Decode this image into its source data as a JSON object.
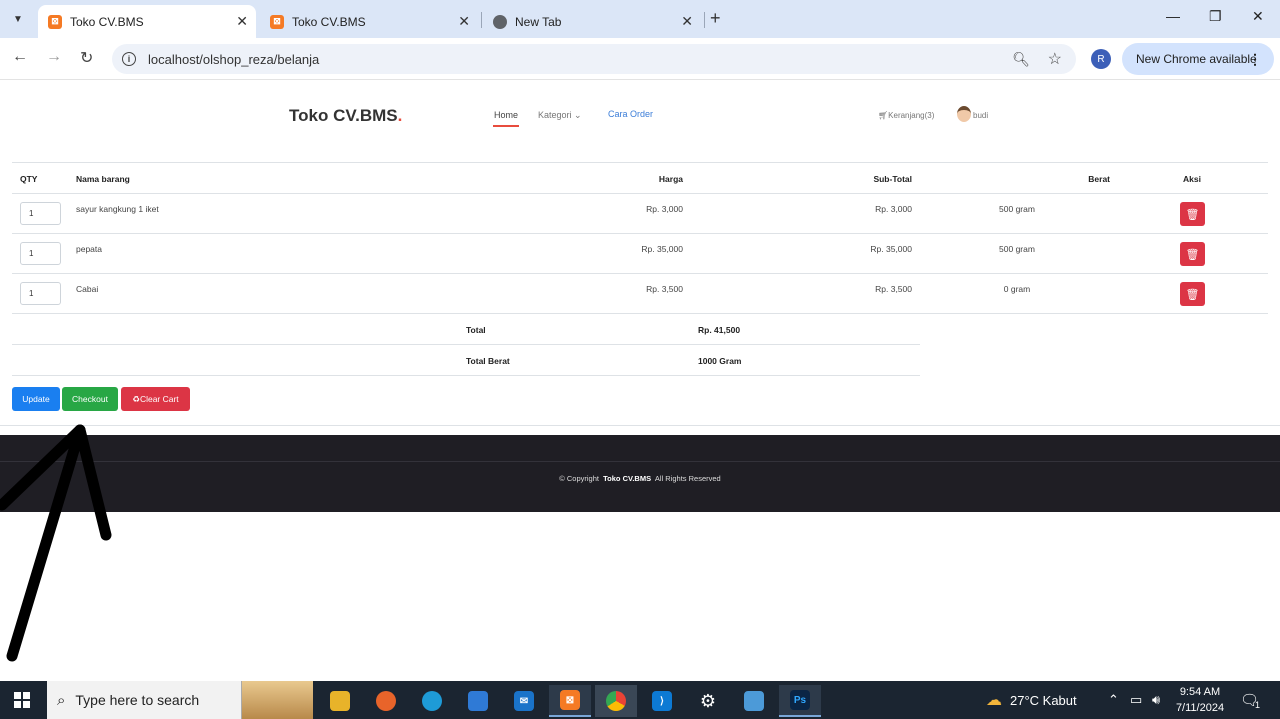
{
  "browser": {
    "tabs": [
      {
        "title": "Toko CV.BMS",
        "favicon": "xampp-icon",
        "active": true
      },
      {
        "title": "Toko CV.BMS",
        "favicon": "xampp-icon",
        "active": false
      },
      {
        "title": "New Tab",
        "favicon": "chrome-icon",
        "active": false
      }
    ],
    "url": "localhost/olshop_reza/belanja",
    "profile_initial": "R",
    "update_label": "New Chrome available"
  },
  "header": {
    "brand": "Toko CV.BMS",
    "brand_dot": ".",
    "nav": {
      "home": "Home",
      "kategori": "Kategori",
      "cara_order": "Cara Order"
    },
    "cart_label": "Keranjang(3)",
    "user_name": "budi"
  },
  "cart": {
    "columns": {
      "qty": "QTY",
      "nama": "Nama barang",
      "harga": "Harga",
      "subtotal": "Sub-Total",
      "berat": "Berat",
      "aksi": "Aksi"
    },
    "items": [
      {
        "qty": "1",
        "nama": "sayur kangkung 1 iket",
        "harga": "Rp. 3,000",
        "subtotal": "Rp. 3,000",
        "berat": "500 gram"
      },
      {
        "qty": "1",
        "nama": "pepata",
        "harga": "Rp. 35,000",
        "subtotal": "Rp. 35,000",
        "berat": "500 gram"
      },
      {
        "qty": "1",
        "nama": "Cabai",
        "harga": "Rp. 3,500",
        "subtotal": "Rp. 3,500",
        "berat": "0 gram"
      }
    ],
    "total_label": "Total",
    "total_value": "Rp. 41,500",
    "total_berat_label": "Total Berat",
    "total_berat_value": "1000 Gram"
  },
  "actions": {
    "update": "Update",
    "checkout": "Checkout",
    "clear_cart": "Clear Cart"
  },
  "footer": {
    "copyright": "© Copyright",
    "brand": "Toko CV.BMS",
    "rights": "All Rights Reserved"
  },
  "taskbar": {
    "search_placeholder": "Type here to search",
    "weather": "27°C  Kabut",
    "time": "9:54 AM",
    "date": "7/11/2024",
    "notification_count": "1"
  },
  "colors": {
    "primary": "#1a7ff0",
    "success": "#28a745",
    "danger": "#dc3545",
    "accent": "#e84c3d",
    "footer_bg": "#1f1e24"
  }
}
